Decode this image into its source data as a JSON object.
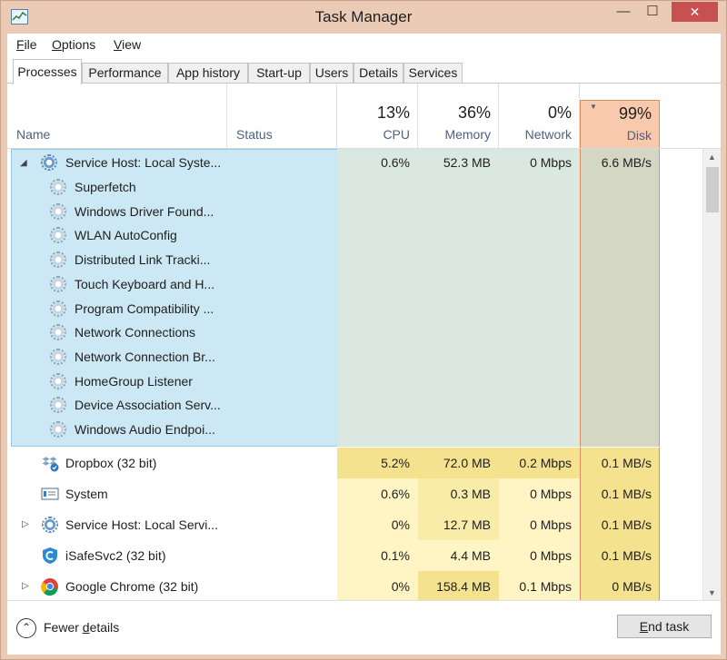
{
  "window": {
    "title": "Task Manager",
    "minimize": "—",
    "maximize": "☐",
    "close": "✕"
  },
  "menu": [
    {
      "pre": "",
      "ul": "F",
      "post": "ile"
    },
    {
      "pre": "",
      "ul": "O",
      "post": "ptions"
    },
    {
      "pre": "",
      "ul": "V",
      "post": "iew"
    }
  ],
  "tabs": [
    "Processes",
    "Performance",
    "App history",
    "Start-up",
    "Users",
    "Details",
    "Services"
  ],
  "active_tab": "Processes",
  "columns": {
    "name": "Name",
    "status": "Status",
    "cpu": {
      "pct": "13%",
      "label": "CPU"
    },
    "memory": {
      "pct": "36%",
      "label": "Memory"
    },
    "network": {
      "pct": "0%",
      "label": "Network"
    },
    "disk": {
      "pct": "99%",
      "label": "Disk",
      "sort_indicator": "▼"
    }
  },
  "group": {
    "name": "Service Host: Local Syste...",
    "expander": "◢",
    "cpu": "0.6%",
    "memory": "52.3 MB",
    "network": "0 Mbps",
    "disk": "6.6 MB/s",
    "children": [
      "Superfetch",
      "Windows Driver Found...",
      "WLAN AutoConfig",
      "Distributed Link Tracki...",
      "Touch Keyboard and H...",
      "Program Compatibility ...",
      "Network Connections",
      "Network Connection Br...",
      "HomeGroup Listener",
      "Device Association Serv...",
      "Windows Audio Endpoi..."
    ]
  },
  "processes": [
    {
      "name": "Dropbox (32 bit)",
      "icon": "dropbox-icon",
      "expander": "",
      "cpu": "5.2%",
      "memory": "72.0 MB",
      "network": "0.2 Mbps",
      "disk": "0.1 MB/s"
    },
    {
      "name": "System",
      "icon": "system-icon",
      "expander": "",
      "cpu": "0.6%",
      "memory": "0.3 MB",
      "network": "0 Mbps",
      "disk": "0.1 MB/s"
    },
    {
      "name": "Service Host: Local Servi...",
      "icon": "service-gear-icon",
      "expander": "▷",
      "cpu": "0%",
      "memory": "12.7 MB",
      "network": "0 Mbps",
      "disk": "0.1 MB/s"
    },
    {
      "name": "iSafeSvc2 (32 bit)",
      "icon": "isafe-shield-icon",
      "expander": "",
      "cpu": "0.1%",
      "memory": "4.4 MB",
      "network": "0 Mbps",
      "disk": "0.1 MB/s"
    },
    {
      "name": "Google Chrome (32 bit)",
      "icon": "chrome-icon",
      "expander": "▷",
      "cpu": "0%",
      "memory": "158.4 MB",
      "network": "0.1 Mbps",
      "disk": "0 MB/s"
    }
  ],
  "footer": {
    "fewer_pre": "Fewer ",
    "fewer_ul": "d",
    "fewer_post": "etails",
    "fewer_icon": "⌃",
    "end_pre": "",
    "end_ul": "E",
    "end_post": "nd task"
  },
  "colors": {
    "selection": "#cce8f4",
    "heat_light": "#fff4c4",
    "heat_mid": "#f9eca8",
    "heat_strong": "#f5e28f",
    "disk_header": "#f9c9ad",
    "disk_border": "#e08b5c",
    "chrome": "#ebcbb5"
  }
}
